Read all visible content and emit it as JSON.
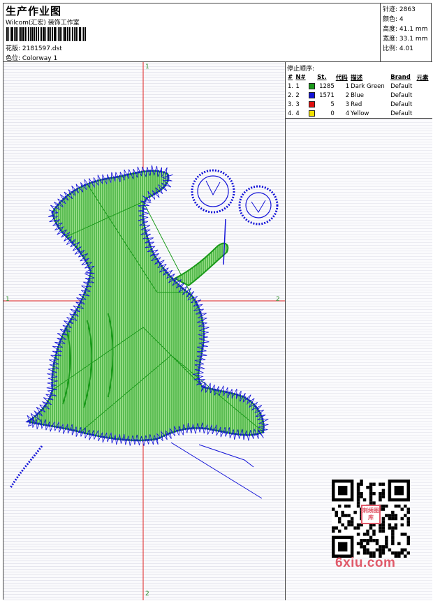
{
  "header": {
    "title": "生产作业图",
    "company": "Wilcom(汇宏) 装饰工作室",
    "pattern_label": "花版:",
    "pattern_value": "2181597.dst",
    "colorway_label": "色位:",
    "colorway_value": "Colorway 1"
  },
  "stats": [
    {
      "label": "针迹:",
      "value": "2863"
    },
    {
      "label": "颜色:",
      "value": "4"
    },
    {
      "label": "高度:",
      "value": "41.1 mm"
    },
    {
      "label": "宽度:",
      "value": "33.1 mm"
    },
    {
      "label": "比例:",
      "value": "4.01"
    }
  ],
  "axes": {
    "top": "1",
    "bottom": "2",
    "left": "1",
    "right": "2"
  },
  "legend": {
    "title": "停止顺序:",
    "columns": [
      "#",
      "N#",
      "St.",
      "代码",
      "描述",
      "Brand",
      "元素"
    ],
    "rows": [
      {
        "idx": "1.",
        "n": "1",
        "color": "#1a9a1a",
        "stitches": "1285",
        "code": "1",
        "desc": "Dark Green",
        "brand": "Default"
      },
      {
        "idx": "2.",
        "n": "2",
        "color": "#1414d8",
        "stitches": "1571",
        "code": "2",
        "desc": "Blue",
        "brand": "Default"
      },
      {
        "idx": "3.",
        "n": "3",
        "color": "#e01010",
        "stitches": "5",
        "code": "3",
        "desc": "Red",
        "brand": "Default"
      },
      {
        "idx": "4.",
        "n": "4",
        "color": "#f0e000",
        "stitches": "0",
        "code": "4",
        "desc": "Yellow",
        "brand": "Default"
      }
    ]
  },
  "colors": {
    "crosshair": "#e02020",
    "axis_label": "#2a8a2a",
    "watermark": "#e05a6a"
  },
  "watermark": {
    "text": "6xiu.com",
    "badge": "刺绣图库"
  }
}
